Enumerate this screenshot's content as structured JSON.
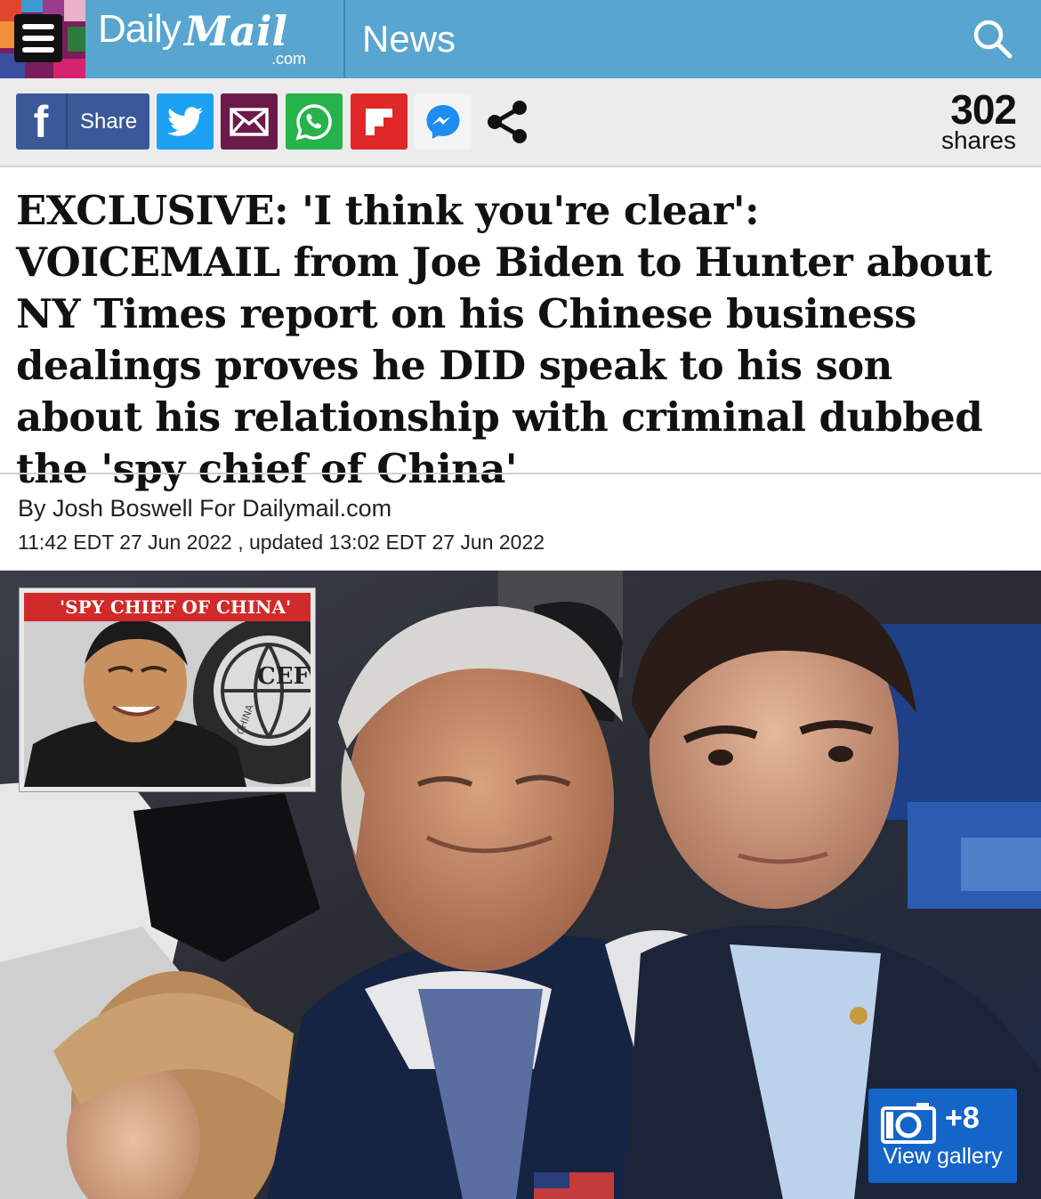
{
  "header": {
    "brand_daily": "Daily",
    "brand_mail": "Mail",
    "brand_com": ".com",
    "section": "News",
    "colors": {
      "bar": "#58a6cf",
      "menu": "#7b1d5c"
    }
  },
  "share_bar": {
    "facebook_label": "Share",
    "count": "302",
    "count_label": "shares",
    "icons": [
      "facebook-icon",
      "twitter-icon",
      "email-icon",
      "whatsapp-icon",
      "flipboard-icon",
      "messenger-icon",
      "share-icon"
    ]
  },
  "article": {
    "headline": "EXCLUSIVE: 'I think you're clear': VOICEMAIL from Joe Biden to Hunter about NY Times report on his Chinese business dealings proves he DID speak to his son about his relationship with criminal dubbed the 'spy chief of China'",
    "byline": "By Josh Boswell For Dailymail.com",
    "dateline": "11:42 EDT 27 Jun 2022 , updated 13:02 EDT 27 Jun 2022"
  },
  "photo": {
    "inset_label": "'SPY CHIEF OF CHINA'",
    "inset_logo_text": "CEF",
    "inset_logo_ring": "CHINA",
    "gallery_count": "+8",
    "gallery_label": "View gallery"
  }
}
